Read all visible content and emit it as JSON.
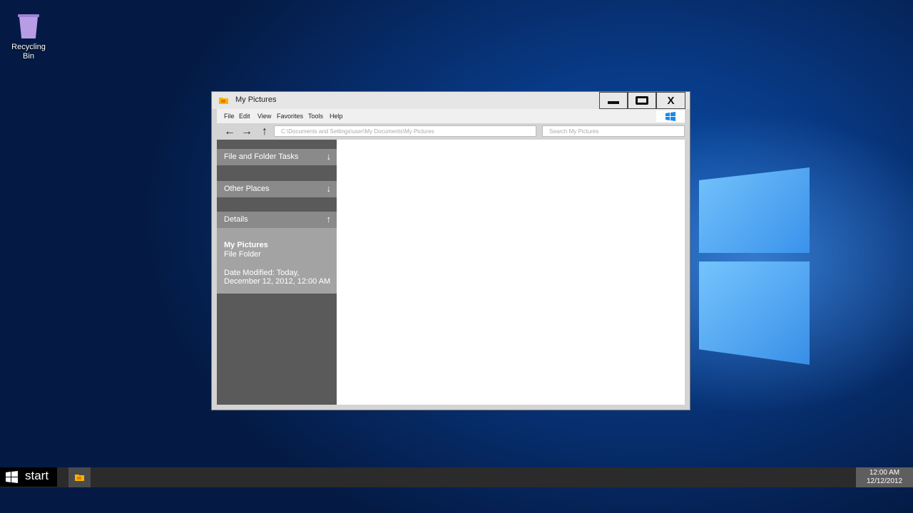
{
  "desktop": {
    "recycle_bin_label": "Recycling Bin"
  },
  "window": {
    "title": "My Pictures",
    "close_label": "X",
    "menu": [
      "File",
      "Edit",
      "View",
      "Favorites",
      "Tools",
      "Help"
    ],
    "nav": {
      "back": "←",
      "forward": "→",
      "up": "↑"
    },
    "address": "C:\\Documents  and Settings\\user\\My  Documents\\My  Pictures",
    "search_placeholder": "Search My Pictures",
    "sidebar": {
      "sections": [
        {
          "label": "File and Folder Tasks",
          "chevron": "↓"
        },
        {
          "label": "Other Places",
          "chevron": "↓"
        },
        {
          "label": "Details",
          "chevron": "↑"
        }
      ],
      "details": {
        "name": "My Pictures",
        "type": "File Folder",
        "modified_line1": "Date Modified: Today,",
        "modified_line2": "December 12, 2012, 12:00 AM"
      }
    }
  },
  "taskbar": {
    "start_label": "start",
    "time": "12:00 AM",
    "date": "12/12/2012"
  },
  "colors": {
    "accent_blue": "#1e88e5",
    "folder_yellow": "#f5b400"
  }
}
